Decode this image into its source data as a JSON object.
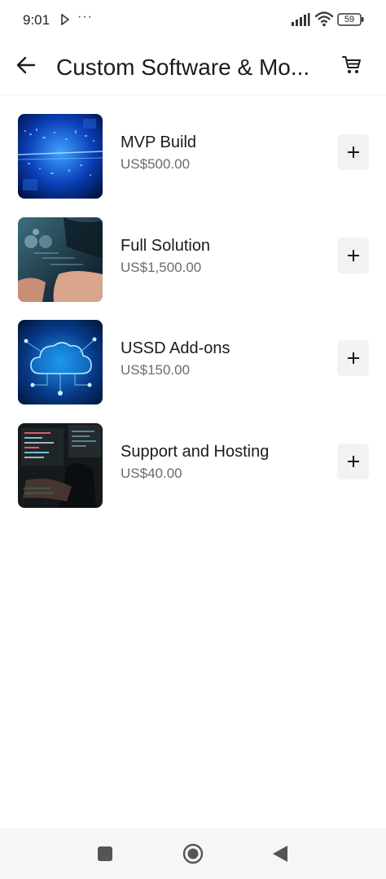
{
  "status_bar": {
    "time": "9:01",
    "more_indicator": "···",
    "battery_level": "59",
    "icons": [
      "media-play-icon",
      "cellular-signal-icon",
      "wifi-icon",
      "battery-icon"
    ]
  },
  "app_bar": {
    "title": "Custom Software & Mo...",
    "back_icon": "arrow-left-icon",
    "cart_icon": "shopping-cart-icon"
  },
  "products": [
    {
      "name": "MVP Build",
      "price": "US$500.00",
      "image": "blue-digital-data-thumbnail",
      "add_icon": "plus-icon"
    },
    {
      "name": "Full Solution",
      "price": "US$1,500.00",
      "image": "hands-touching-hologram-thumbnail",
      "add_icon": "plus-icon"
    },
    {
      "name": "USSD Add-ons",
      "price": "US$150.00",
      "image": "cloud-network-thumbnail",
      "add_icon": "plus-icon"
    },
    {
      "name": "Support and Hosting",
      "price": "US$40.00",
      "image": "developer-at-code-screens-thumbnail",
      "add_icon": "plus-icon"
    }
  ],
  "nav_bar": {
    "icons": [
      "recents-square-icon",
      "home-circle-icon",
      "back-triangle-icon"
    ]
  },
  "colors": {
    "background": "#ffffff",
    "text_primary": "#1b1b1f",
    "text_secondary": "#6b6b70",
    "add_button_bg": "#f2f2f3",
    "nav_bar_bg": "#f5f6f8"
  }
}
